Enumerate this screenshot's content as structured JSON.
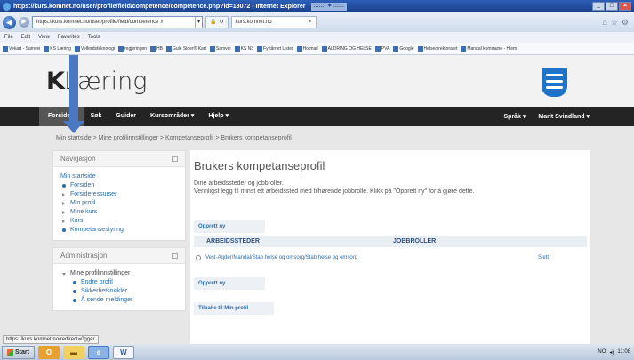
{
  "browser": {
    "title": "https://kurs.komnet.no/user/profile/field/competence/competence.php?id=18072 - Internet Explorer",
    "title_extra": "::::::: ✦ ::::::",
    "address": "https://kurs.komnet.no/user/profile/field/competence",
    "tab_label": "kurs.komnet.no",
    "menu": [
      "File",
      "Edit",
      "View",
      "Favorites",
      "Tools"
    ],
    "favorites": [
      "Vekart - Samvei",
      "KS Læring",
      "Velferdsteknologi",
      "regjeringen",
      "HB",
      "Gule Sider® Kart",
      "Samvei",
      "KS N3",
      "Fyrtårnet Lister",
      "Hotmail",
      "ALDRING OG HELSE",
      "PVA",
      "Google",
      "Helsedirektoratet",
      "Mandal kommune - Hjem"
    ]
  },
  "site": {
    "logo_k": "K",
    "logo_rest": "Læring",
    "nav": {
      "home": "Forsiden",
      "search": "Søk",
      "guides": "Guider",
      "course_areas": "Kursområder ▾",
      "help": "Hjelp ▾",
      "language": "Språk ▾",
      "user": "Marit Svindland ▾"
    },
    "breadcrumb": "Min startside > Mine profilinnstillinger > Kompetanseprofil > Brukers kompetanseprofil"
  },
  "sidebar": {
    "nav_title": "Navigasjon",
    "nav_items": [
      {
        "label": "Min startside",
        "style": "plain"
      },
      {
        "label": "Forsiden",
        "style": "bullet"
      },
      {
        "label": "Forsideressurser",
        "style": "tri"
      },
      {
        "label": "Min profil",
        "style": "tri"
      },
      {
        "label": "Mine kurs",
        "style": "tri"
      },
      {
        "label": "Kurs",
        "style": "tri"
      },
      {
        "label": "Kompetansestyring",
        "style": "bullet"
      }
    ],
    "admin_title": "Administrasjon",
    "admin_group": "Mine profilinnstillinger",
    "admin_items": [
      "Endre profil",
      "Sikkerhetsnøkler",
      "Å sende meldinger"
    ]
  },
  "main": {
    "title": "Brukers kompetanseprofil",
    "intro_1": "Dine arbeidssteder og jobbroller.",
    "intro_2": "Vennligst legg til minst ett arbeidssted med tilhørende jobbrolle. Klikk på \"Opprett ny\" for å gjøre dette.",
    "create_new": "Opprett ny",
    "col_workplaces": "ARBEIDSSTEDER",
    "col_roles": "JOBBROLLER",
    "rows": [
      {
        "workplace": "Vest-Agder/Mandal/Stab helse og omsorg/Stab helse og omsorg",
        "action": "Slett"
      }
    ],
    "create_new_2": "Opprett ny",
    "back_link": "Tilbake til Min profil"
  },
  "status_url": "https://kurs.komnet.no/redirect=0gger",
  "taskbar": {
    "start": "Start",
    "lang": "NO",
    "time": "11:08"
  }
}
